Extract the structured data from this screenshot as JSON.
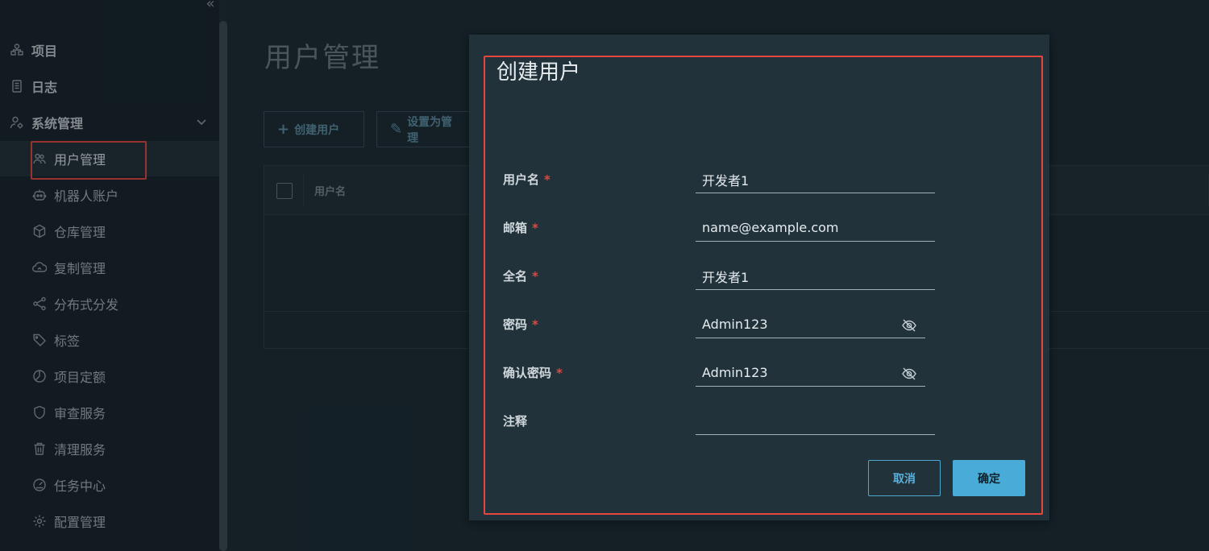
{
  "sidebar": {
    "collapse_glyph": "«",
    "items": [
      {
        "label": "项目",
        "icon": "projects-icon",
        "level": "top"
      },
      {
        "label": "日志",
        "icon": "logs-icon",
        "level": "top"
      },
      {
        "label": "系统管理",
        "icon": "system-admin-icon",
        "level": "top",
        "expanded": true
      },
      {
        "label": "用户管理",
        "icon": "users-icon",
        "level": "sub",
        "active": true
      },
      {
        "label": "机器人账户",
        "icon": "robot-icon",
        "level": "sub"
      },
      {
        "label": "仓库管理",
        "icon": "registry-icon",
        "level": "sub"
      },
      {
        "label": "复制管理",
        "icon": "replication-icon",
        "level": "sub"
      },
      {
        "label": "分布式分发",
        "icon": "distribution-icon",
        "level": "sub"
      },
      {
        "label": "标签",
        "icon": "tag-icon",
        "level": "sub"
      },
      {
        "label": "项目定额",
        "icon": "quota-icon",
        "level": "sub"
      },
      {
        "label": "审查服务",
        "icon": "shield-icon",
        "level": "sub"
      },
      {
        "label": "清理服务",
        "icon": "trash-icon",
        "level": "sub"
      },
      {
        "label": "任务中心",
        "icon": "dashboard-icon",
        "level": "sub"
      },
      {
        "label": "配置管理",
        "icon": "gear-icon",
        "level": "sub"
      }
    ]
  },
  "main": {
    "page_title": "用户管理",
    "toolbar": {
      "create_user": "创建用户",
      "set_admin": "设置为管理"
    },
    "table": {
      "col_username": "用户名"
    }
  },
  "modal": {
    "title": "创建用户",
    "fields": {
      "username": {
        "label": "用户名",
        "required": true,
        "value": "开发者1"
      },
      "email": {
        "label": "邮箱",
        "required": true,
        "value": "name@example.com"
      },
      "fullname": {
        "label": "全名",
        "required": true,
        "value": "开发者1"
      },
      "password": {
        "label": "密码",
        "required": true,
        "value": "Admin123"
      },
      "confirm_password": {
        "label": "确认密码",
        "required": true,
        "value": "Admin123"
      },
      "comment": {
        "label": "注释",
        "required": false,
        "value": ""
      }
    },
    "required_mark": "*",
    "cancel_label": "取消",
    "ok_label": "确定"
  },
  "colors": {
    "accent": "#49acd8",
    "highlight": "#e5473f",
    "required": "#d94b42"
  }
}
